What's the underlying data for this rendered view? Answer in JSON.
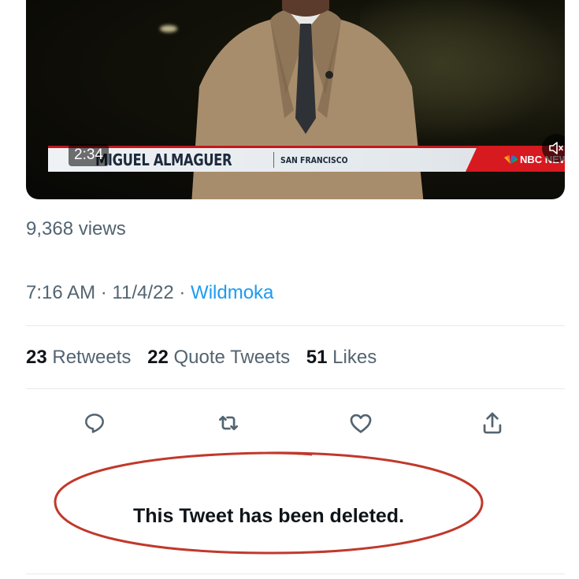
{
  "video": {
    "duration": "2:34",
    "lower_third": {
      "name": "MIGUEL ALMAGUER",
      "location": "SAN FRANCISCO",
      "network": "NBC NEWS"
    },
    "icons": {
      "mute": "speaker-muted-icon",
      "network_logo": "peacock-logo-icon"
    }
  },
  "tweet": {
    "views": "9,368 views",
    "time": "7:16 AM",
    "date": "11/4/22",
    "separator": "·",
    "source": "Wildmoka"
  },
  "stats": {
    "retweets_count": "23",
    "retweets_label": "Retweets",
    "quotes_count": "22",
    "quotes_label": "Quote Tweets",
    "likes_count": "51",
    "likes_label": "Likes"
  },
  "actions": [
    {
      "name": "reply",
      "icon": "reply-icon"
    },
    {
      "name": "retweet",
      "icon": "retweet-icon"
    },
    {
      "name": "like",
      "icon": "heart-icon"
    },
    {
      "name": "share",
      "icon": "share-icon"
    }
  ],
  "deleted_notice": "This Tweet has been deleted.",
  "colors": {
    "link": "#1d9bf0",
    "muted_text": "#536471",
    "annotation_circle": "#c0392b",
    "icon": "#536471"
  }
}
